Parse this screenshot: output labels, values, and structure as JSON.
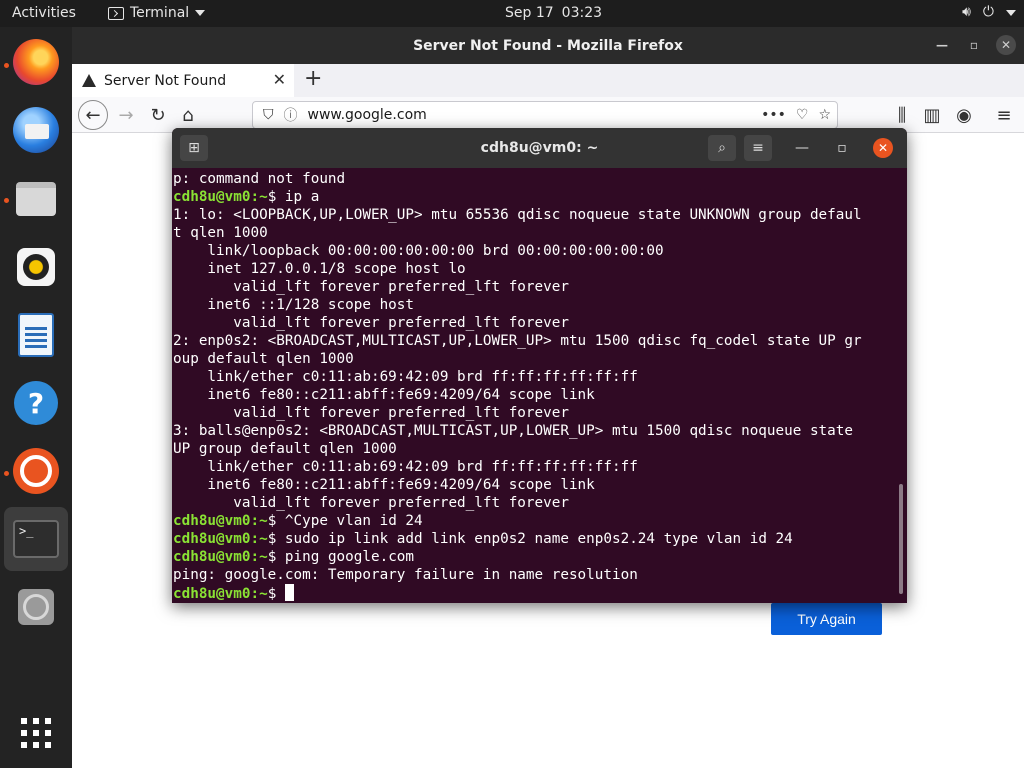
{
  "topbar": {
    "activities": "Activities",
    "app_name": "Terminal",
    "date": "Sep 17",
    "time": "03:23",
    "tray_icons": [
      "volume-icon",
      "power-icon",
      "chevron-down-icon"
    ]
  },
  "dock": {
    "items": [
      {
        "name": "firefox",
        "running": true
      },
      {
        "name": "thunderbird",
        "running": false
      },
      {
        "name": "files",
        "running": true
      },
      {
        "name": "rhythmbox",
        "running": false
      },
      {
        "name": "libreoffice-writer",
        "running": false
      },
      {
        "name": "help",
        "running": false
      },
      {
        "name": "ubuntu-software",
        "running": true
      },
      {
        "name": "terminal",
        "running": true,
        "active": true
      },
      {
        "name": "disc",
        "running": false
      }
    ],
    "term_icon_text": ">_"
  },
  "firefox": {
    "window_title": "Server Not Found - Mozilla Firefox",
    "tab_label": "Server Not Found",
    "new_tab": "+",
    "url_host": "www.google.com",
    "url_menu": "•••",
    "try_again": "Try Again"
  },
  "terminal": {
    "title": "cdh8u@vm0: ~",
    "prompt_user": "cdh8u@vm0",
    "prompt_path": ":~",
    "prompt_char": "$",
    "lines": [
      {
        "type": "out",
        "text": "p: command not found"
      },
      {
        "type": "cmd",
        "text": " ip a"
      },
      {
        "type": "out",
        "text": "1: lo: <LOOPBACK,UP,LOWER_UP> mtu 65536 qdisc noqueue state UNKNOWN group defaul"
      },
      {
        "type": "out",
        "text": "t qlen 1000"
      },
      {
        "type": "out",
        "text": "    link/loopback 00:00:00:00:00:00 brd 00:00:00:00:00:00"
      },
      {
        "type": "out",
        "text": "    inet 127.0.0.1/8 scope host lo"
      },
      {
        "type": "out",
        "text": "       valid_lft forever preferred_lft forever"
      },
      {
        "type": "out",
        "text": "    inet6 ::1/128 scope host"
      },
      {
        "type": "out",
        "text": "       valid_lft forever preferred_lft forever"
      },
      {
        "type": "out",
        "text": "2: enp0s2: <BROADCAST,MULTICAST,UP,LOWER_UP> mtu 1500 qdisc fq_codel state UP gr"
      },
      {
        "type": "out",
        "text": "oup default qlen 1000"
      },
      {
        "type": "out",
        "text": "    link/ether c0:11:ab:69:42:09 brd ff:ff:ff:ff:ff:ff"
      },
      {
        "type": "out",
        "text": "    inet6 fe80::c211:abff:fe69:4209/64 scope link"
      },
      {
        "type": "out",
        "text": "       valid_lft forever preferred_lft forever"
      },
      {
        "type": "out",
        "text": "3: balls@enp0s2: <BROADCAST,MULTICAST,UP,LOWER_UP> mtu 1500 qdisc noqueue state"
      },
      {
        "type": "out",
        "text": "UP group default qlen 1000"
      },
      {
        "type": "out",
        "text": "    link/ether c0:11:ab:69:42:09 brd ff:ff:ff:ff:ff:ff"
      },
      {
        "type": "out",
        "text": "    inet6 fe80::c211:abff:fe69:4209/64 scope link"
      },
      {
        "type": "out",
        "text": "       valid_lft forever preferred_lft forever"
      },
      {
        "type": "cmd",
        "text": " ^Cype vlan id 24"
      },
      {
        "type": "cmd",
        "text": " sudo ip link add link enp0s2 name enp0s2.24 type vlan id 24"
      },
      {
        "type": "cmd",
        "text": " ping google.com"
      },
      {
        "type": "out",
        "text": "ping: google.com: Temporary failure in name resolution"
      },
      {
        "type": "cmd",
        "text": " ",
        "cursor": true
      }
    ]
  },
  "colors": {
    "terminal_bg": "#300a24",
    "prompt_green": "#8ae234",
    "ubuntu_orange": "#e95420",
    "firefox_button_blue": "#0a60d9"
  }
}
